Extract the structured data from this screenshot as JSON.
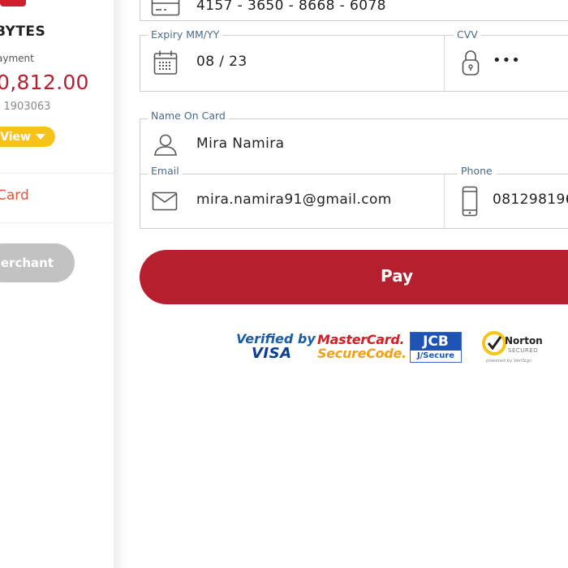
{
  "sidebar": {
    "merchant_name": "BYTES",
    "payment_label": "ayment",
    "amount": "0,812.00",
    "order_id": ": 1903063",
    "view_button": "View",
    "card_link": "Card",
    "merchant_button": "Merchant"
  },
  "form": {
    "card_number": {
      "value": "4157 - 3650 - 8668 - 6078"
    },
    "expiry": {
      "label": "Expiry MM/YY",
      "value": "08 / 23"
    },
    "cvv": {
      "label": "CVV",
      "value": "•••"
    },
    "name_on_card": {
      "label": "Name On Card",
      "value": "Mira Namira"
    },
    "email": {
      "label": "Email",
      "value": "mira.namira91@gmail.com"
    },
    "phone": {
      "label": "Phone",
      "value": "081298196"
    },
    "pay_button": "Pay"
  },
  "security_logos": {
    "visa_line1": "Verified by",
    "visa_line2": "VISA",
    "mastercard_line1": "MasterCard.",
    "mastercard_line2": "SecureCode.",
    "jcb_top": "JCB",
    "jcb_bottom": "J/Secure",
    "norton_name": "Norton",
    "norton_secured": "SECURED",
    "norton_powered": "powered by VeriSign"
  },
  "colors": {
    "brand_red": "#b51f2e",
    "accent_yellow": "#f7c21a",
    "link_orange": "#e0563a",
    "label_blue": "#4b6a8a"
  }
}
